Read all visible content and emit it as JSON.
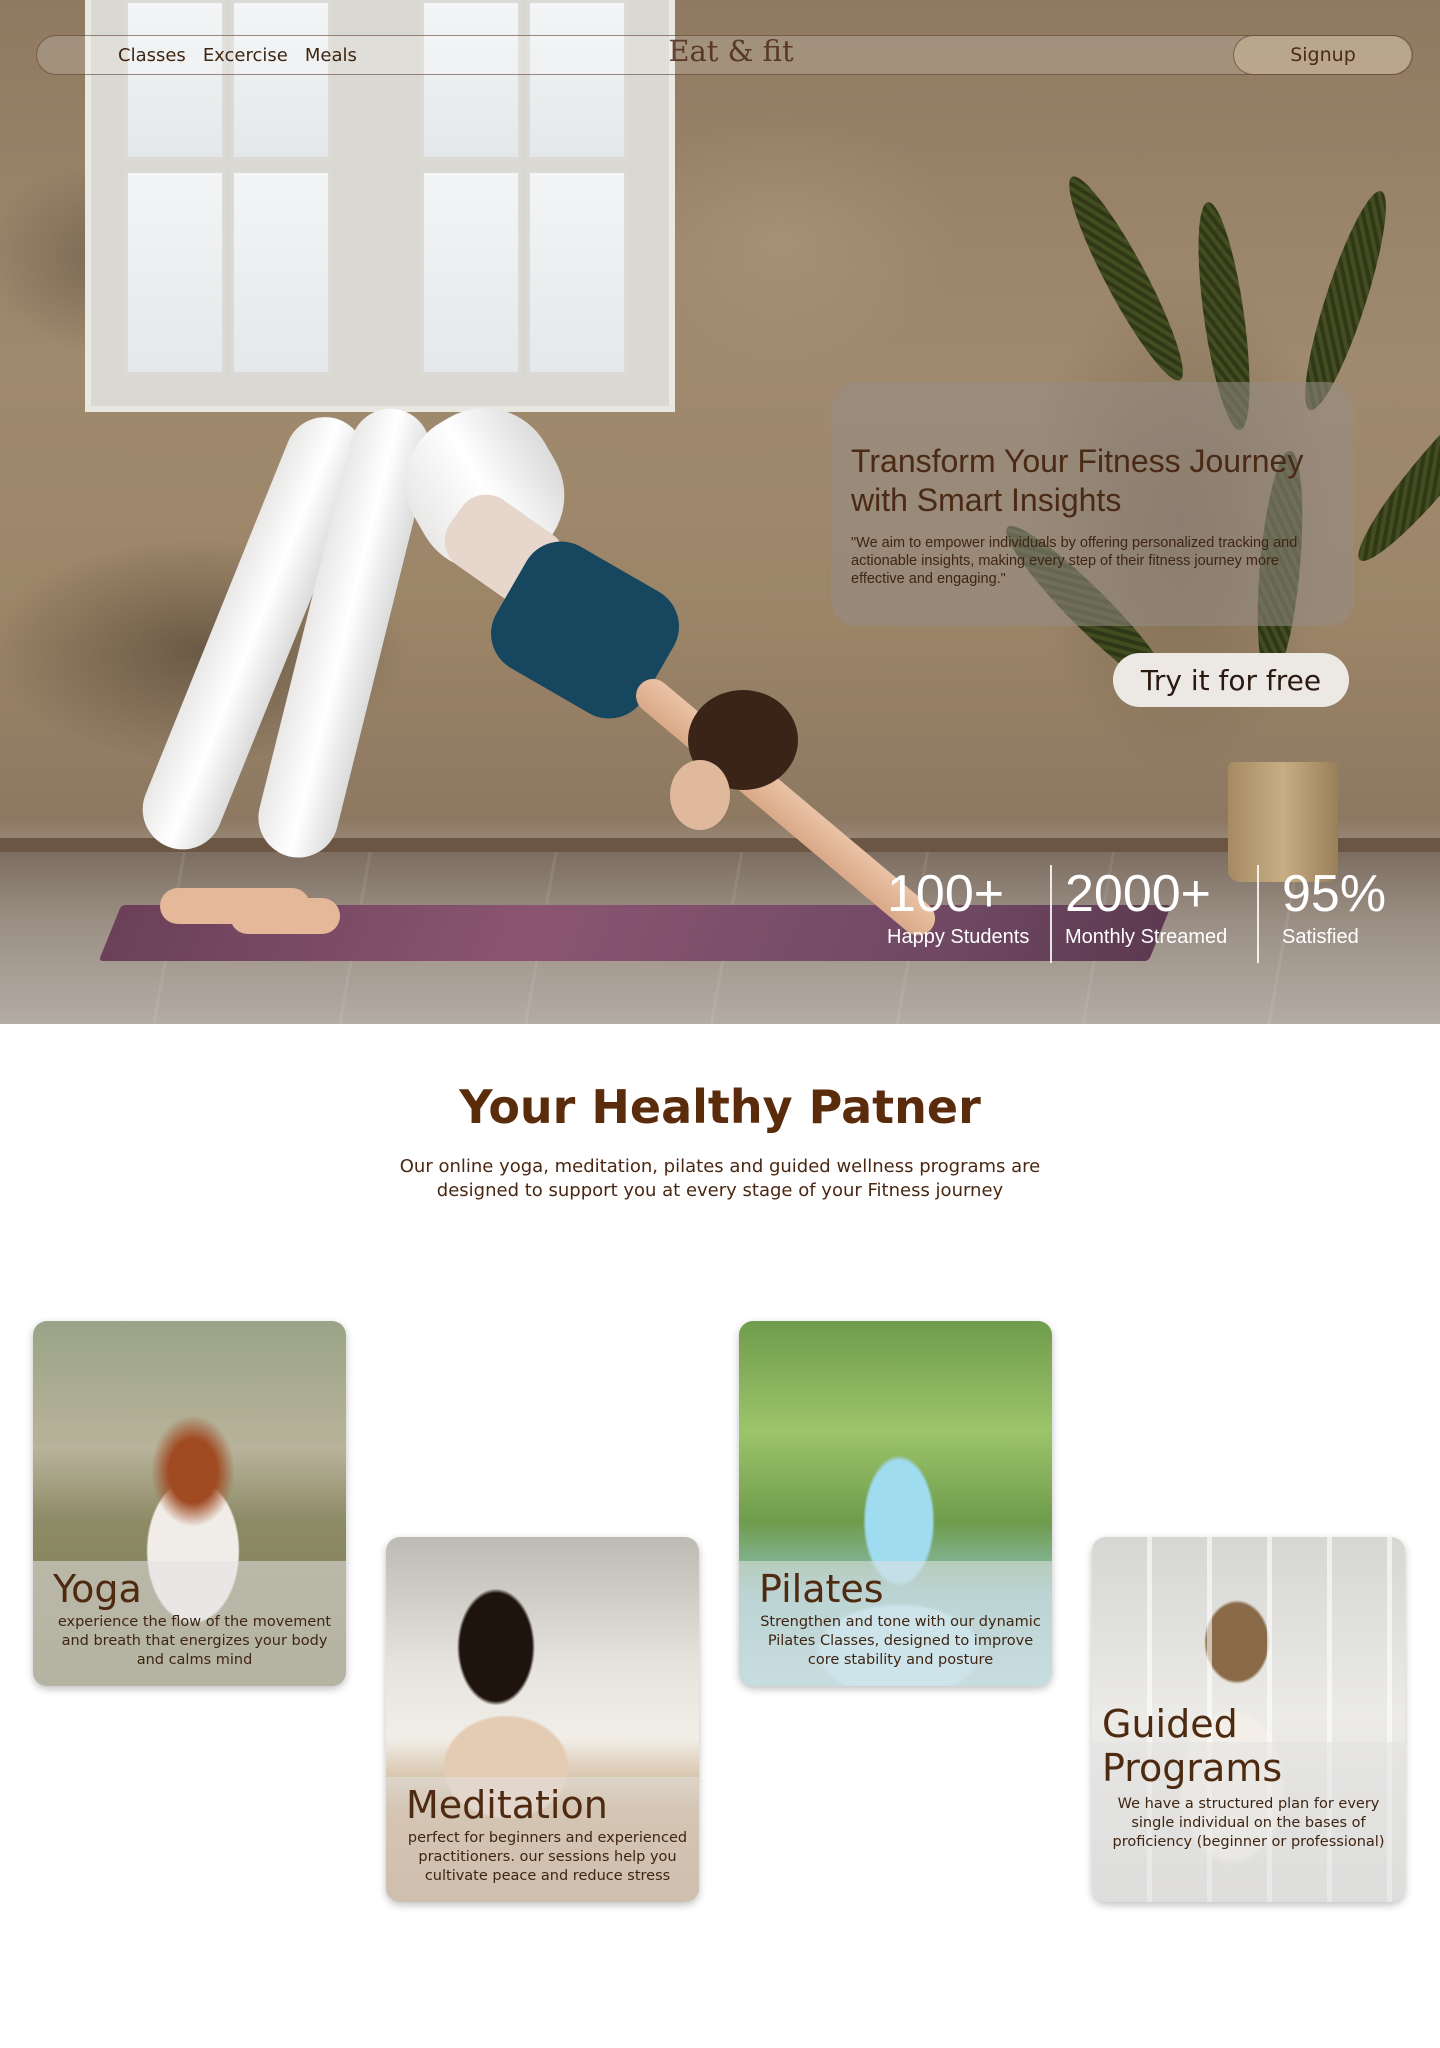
{
  "nav": {
    "links": [
      "Classes",
      "Excercise",
      "Meals"
    ],
    "brand": "Eat & fit",
    "signup_label": "Signup"
  },
  "hero": {
    "title": "Transform Your Fitness Journey with Smart Insights",
    "quote": "\"We aim to empower individuals by offering personalized tracking and actionable insights, making every step of their fitness journey more effective and engaging.\"",
    "cta_label": "Try it for free",
    "stats": [
      {
        "value": "100+",
        "label": "Happy Students"
      },
      {
        "value": "2000+",
        "label": "Monthly Streamed"
      },
      {
        "value": "95%",
        "label": "Satisfied"
      }
    ]
  },
  "section": {
    "title": "Your Healthy Patner",
    "subtitle": "Our online yoga, meditation, pilates and guided wellness programs are designed to support you at every stage of your Fitness journey"
  },
  "cards": [
    {
      "title": "Yoga",
      "description": "experience the flow of the movement and breath that energizes your body and calms mind"
    },
    {
      "title": "Meditation",
      "description": "perfect for beginners and experienced practitioners. our sessions help you cultivate peace and reduce stress"
    },
    {
      "title": "Pilates",
      "description": "Strengthen and tone with our dynamic Pilates Classes, designed to improve core stability and posture"
    },
    {
      "title": "Guided Programs",
      "description": "We have a structured plan for every single individual on the bases of proficiency (beginner or professional)"
    }
  ],
  "colors": {
    "brand_brown": "#5a2c0c",
    "text_brown": "#4a2712",
    "cta_background": "#ece8e4"
  }
}
